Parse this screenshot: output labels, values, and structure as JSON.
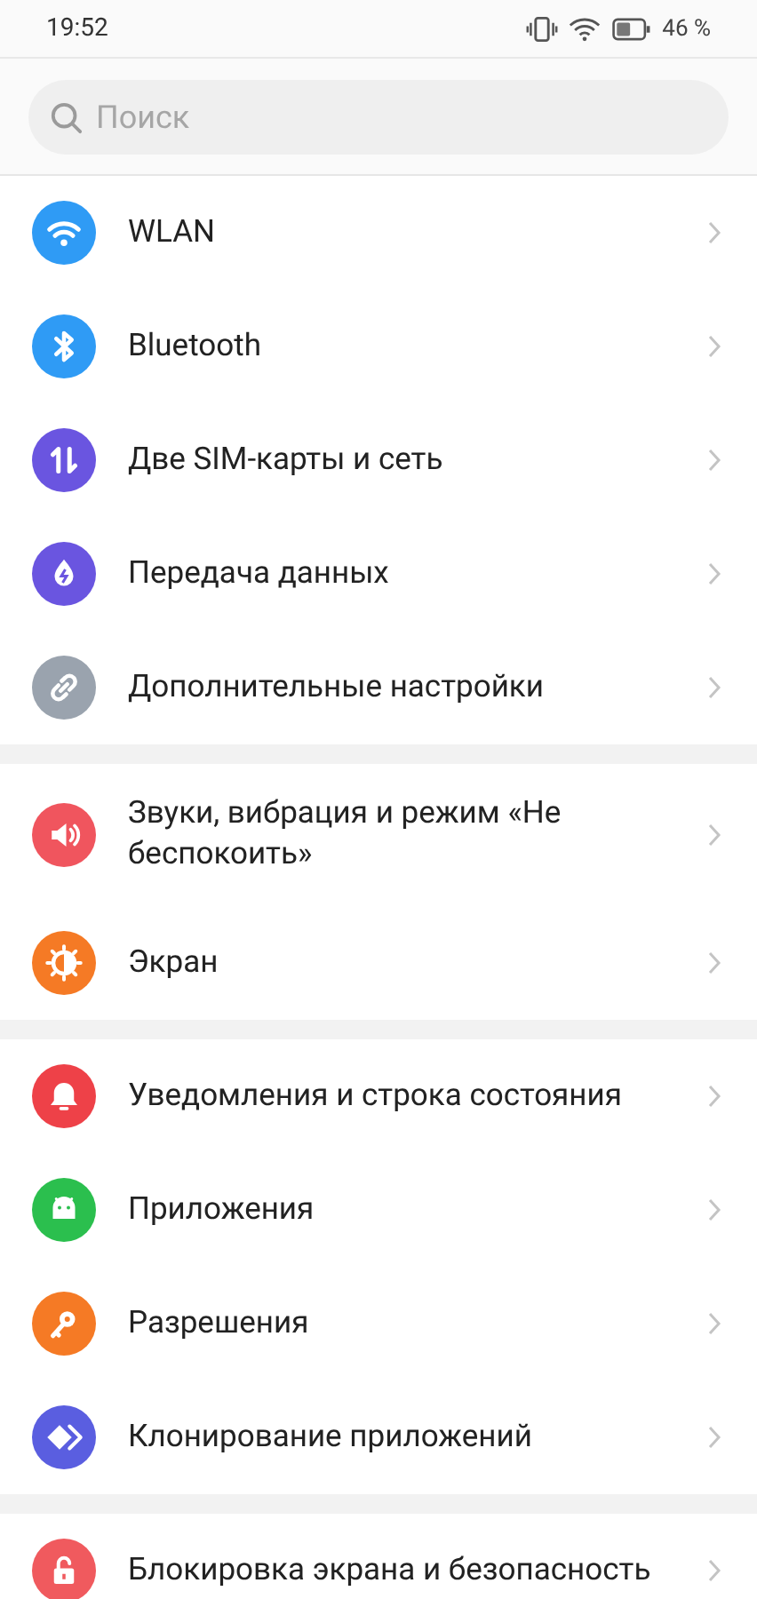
{
  "status_bar": {
    "time": "19:52",
    "battery_text": "46 %"
  },
  "search": {
    "placeholder": "Поиск"
  },
  "sections": [
    {
      "items": [
        {
          "kind": "wifi",
          "color": "#2f9bf5",
          "label": "WLAN"
        },
        {
          "kind": "bluetooth",
          "color": "#2f9bf5",
          "label": "Bluetooth"
        },
        {
          "kind": "sim",
          "color": "#6a55e0",
          "label": "Две SIM-карты и сеть"
        },
        {
          "kind": "data",
          "color": "#6a55e0",
          "label": "Передача данных"
        },
        {
          "kind": "link",
          "color": "#9aa3ae",
          "label": "Дополнительные настройки"
        }
      ]
    },
    {
      "items": [
        {
          "kind": "sound",
          "color": "#f0555e",
          "label": "Звуки, вибрация и режим «Не беспокоить»"
        },
        {
          "kind": "screen",
          "color": "#f57a25",
          "label": "Экран"
        }
      ]
    },
    {
      "items": [
        {
          "kind": "bell",
          "color": "#ee4148",
          "label": "Уведомления и строка состояния"
        },
        {
          "kind": "android",
          "color": "#2bbf4e",
          "label": "Приложения"
        },
        {
          "kind": "key",
          "color": "#f57a25",
          "label": "Разрешения"
        },
        {
          "kind": "clone",
          "color": "#5a5ee0",
          "label": "Клонирование приложений"
        }
      ]
    },
    {
      "items": [
        {
          "kind": "lock",
          "color": "#f05a5e",
          "label": "Блокировка экрана и безопасность"
        }
      ]
    }
  ]
}
